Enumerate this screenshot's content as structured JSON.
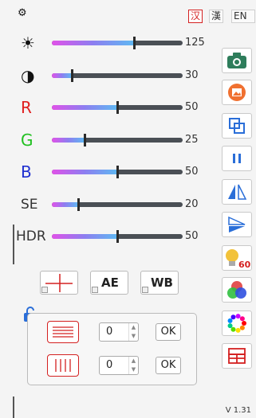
{
  "language_tabs": [
    "汉",
    "漢",
    "EN"
  ],
  "sliders": [
    {
      "label": "☀",
      "value": 125,
      "max": 200,
      "label_color": "#111111"
    },
    {
      "label": "◑",
      "value": 30,
      "max": 200,
      "label_color": "#111111"
    },
    {
      "label": "R",
      "value": 50,
      "max": 100,
      "label_color": "#e02020"
    },
    {
      "label": "G",
      "value": 25,
      "max": 100,
      "label_color": "#20c020"
    },
    {
      "label": "B",
      "value": 50,
      "max": 100,
      "label_color": "#2030d0"
    },
    {
      "label": "SE",
      "value": 20,
      "max": 100,
      "label_color": "#333333"
    },
    {
      "label": "HDR",
      "value": 50,
      "max": 100,
      "label_color": "#333333"
    }
  ],
  "tools": [
    {
      "name": "camera-icon",
      "color": "#2e7d5b"
    },
    {
      "name": "picture-icon",
      "color": "#f07030"
    },
    {
      "name": "overlap-icon",
      "color": "#2a6ed8"
    },
    {
      "name": "pause-icon",
      "color": "#2a6ed8"
    },
    {
      "name": "flip-horizontal-icon",
      "color": "#2a6ed8"
    },
    {
      "name": "flip-vertical-icon",
      "color": "#2a6ed8"
    },
    {
      "name": "bulb-icon",
      "color": "#f2c23a",
      "badge": "60"
    },
    {
      "name": "color-circles-icon",
      "color": "#e04040"
    },
    {
      "name": "color-wheel-icon",
      "color": "#a040c0"
    },
    {
      "name": "grid-layout-icon",
      "color": "#d42020"
    }
  ],
  "buttons": {
    "ae": "AE",
    "wb": "WB"
  },
  "line_controls": [
    {
      "value": "0",
      "ok": "OK"
    },
    {
      "value": "0",
      "ok": "OK"
    }
  ],
  "version": "V 1.31"
}
